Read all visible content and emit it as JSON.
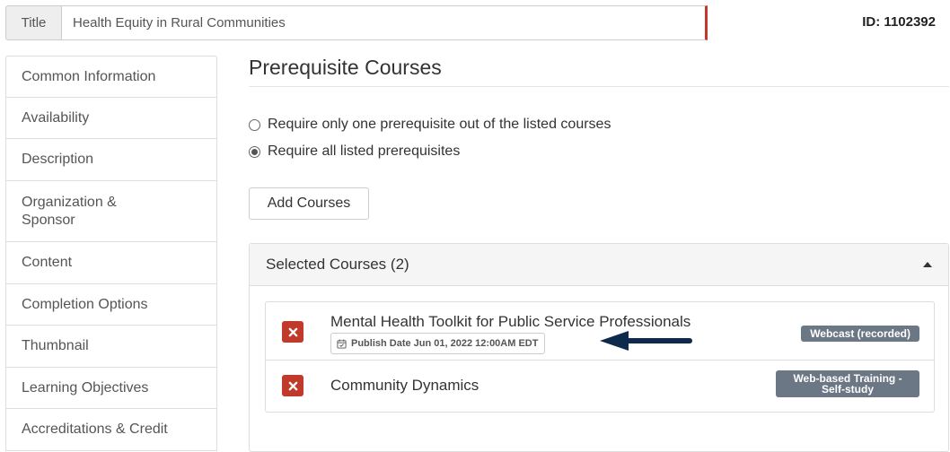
{
  "header": {
    "title_label": "Title",
    "title_value": "Health Equity in Rural Communities",
    "record_id": "ID: 1102392"
  },
  "sidebar": {
    "items": [
      {
        "label": "Common Information"
      },
      {
        "label": "Availability"
      },
      {
        "label": "Description"
      },
      {
        "label": "Organization & Sponsor"
      },
      {
        "label": "Content"
      },
      {
        "label": "Completion Options"
      },
      {
        "label": "Thumbnail"
      },
      {
        "label": "Learning Objectives"
      },
      {
        "label": "Accreditations & Credit"
      }
    ]
  },
  "main": {
    "page_title": "Prerequisite Courses",
    "options": [
      {
        "label": "Require only one prerequisite out of the listed courses",
        "checked": false
      },
      {
        "label": "Require all listed prerequisites",
        "checked": true
      }
    ],
    "add_button": "Add Courses",
    "panel": {
      "title": "Selected Courses (2)",
      "courses": [
        {
          "name": "Mental Health Toolkit for Public Service Professionals",
          "publish": "Publish Date Jun 01, 2022 12:00AM EDT",
          "type": "Webcast (recorded)"
        },
        {
          "name": "Community Dynamics",
          "type_line1": "Web-based Training -",
          "type_line2": "Self-study"
        }
      ]
    }
  },
  "colors": {
    "remove": "#c0392b",
    "badge": "#6b7785",
    "arrow": "#0d2a4d",
    "title_accent": "#c0392b"
  },
  "icons": {
    "remove": "close-icon",
    "publish": "calendar-check-icon",
    "collapse": "caret-up-icon",
    "arrow": "arrow-left-icon"
  }
}
